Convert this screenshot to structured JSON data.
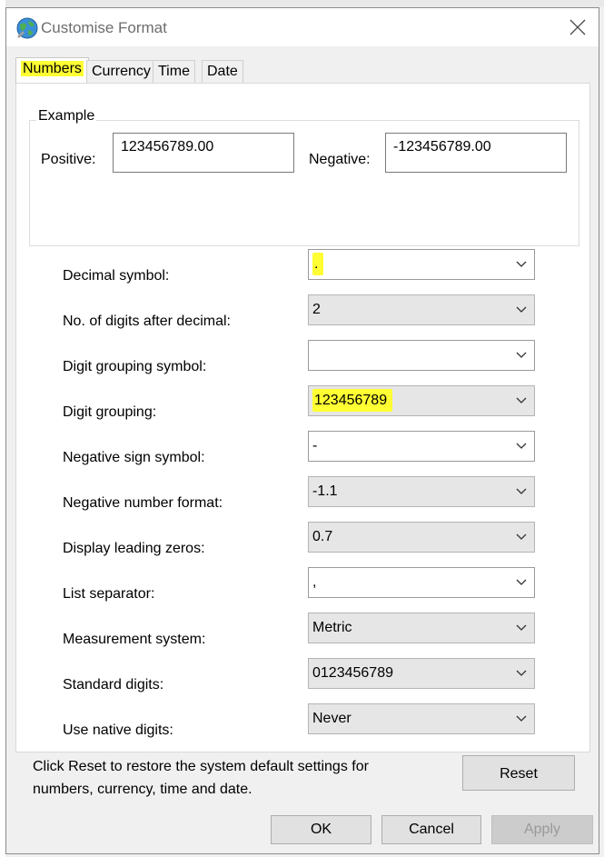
{
  "window": {
    "title": "Customise Format"
  },
  "tabs": [
    {
      "label": "Numbers",
      "active": true
    },
    {
      "label": "Currency",
      "active": false
    },
    {
      "label": "Time",
      "active": false
    },
    {
      "label": "Date",
      "active": false
    }
  ],
  "example": {
    "legend": "Example",
    "positive_label": "Positive:",
    "positive_value": "123456789.00",
    "negative_label": "Negative:",
    "negative_value": "-123456789.00"
  },
  "settings": [
    {
      "label": "Decimal symbol:",
      "value": ".",
      "editable": true,
      "highlight": true
    },
    {
      "label": "No. of digits after decimal:",
      "value": "2",
      "editable": false,
      "highlight": false
    },
    {
      "label": "Digit grouping symbol:",
      "value": "",
      "editable": true,
      "highlight": false
    },
    {
      "label": "Digit grouping:",
      "value": "123456789",
      "editable": false,
      "highlight": true
    },
    {
      "label": "Negative sign symbol:",
      "value": "-",
      "editable": true,
      "highlight": false
    },
    {
      "label": "Negative number format:",
      "value": "-1.1",
      "editable": false,
      "highlight": false
    },
    {
      "label": "Display leading zeros:",
      "value": "0.7",
      "editable": false,
      "highlight": false
    },
    {
      "label": "List separator:",
      "value": ",",
      "editable": true,
      "highlight": false
    },
    {
      "label": "Measurement system:",
      "value": "Metric",
      "editable": false,
      "highlight": false
    },
    {
      "label": "Standard digits:",
      "value": "0123456789",
      "editable": false,
      "highlight": false
    },
    {
      "label": "Use native digits:",
      "value": "Never",
      "editable": false,
      "highlight": false
    }
  ],
  "reset": {
    "text_line1": "Click Reset to restore the system default settings for",
    "text_line2": "numbers, currency, time and date.",
    "button": "Reset"
  },
  "buttons": {
    "ok": "OK",
    "cancel": "Cancel",
    "apply": "Apply"
  },
  "colors": {
    "highlight": "#ffff33",
    "combo_disabled": "#e6e6e6",
    "panel": "#ffffff",
    "dialog_bg": "#f0f0f0"
  },
  "icons": {
    "title": "globe-icon",
    "close": "close-icon",
    "dropdown": "chevron-down-icon"
  }
}
